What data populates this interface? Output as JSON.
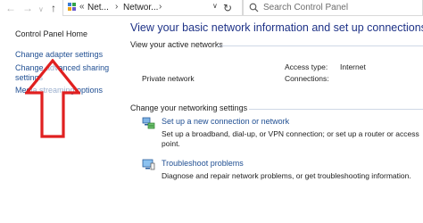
{
  "address_bar": {
    "back_icon": "left-arrow",
    "forward_icon": "right-arrow",
    "up_icon": "up-arrow",
    "breadcrumb": [
      "Net...",
      "Networ..."
    ],
    "refresh_icon": "refresh",
    "search_placeholder": "Search Control Panel"
  },
  "left_pane": {
    "home": "Control Panel Home",
    "links": [
      "Change adapter settings",
      "Change advanced sharing",
      "settings",
      "Media streaming options"
    ]
  },
  "main": {
    "title": "View your basic network information and set up connections",
    "active_networks_label": "View your active networks",
    "network_name": "Private network",
    "access_type_label": "Access type:",
    "access_type_value": "Internet",
    "connections_label": "Connections:",
    "change_settings_label": "Change your networking settings",
    "tasks": [
      {
        "icon": "new-connection",
        "link": "Set up a new connection or network",
        "description": "Set up a broadband, dial-up, or VPN connection; or set up a router or access point."
      },
      {
        "icon": "troubleshoot",
        "link": "Troubleshoot problems",
        "description": "Diagnose and repair network problems, or get troubleshooting information."
      }
    ]
  },
  "annotation": {
    "arrow_color": "#e02020"
  }
}
